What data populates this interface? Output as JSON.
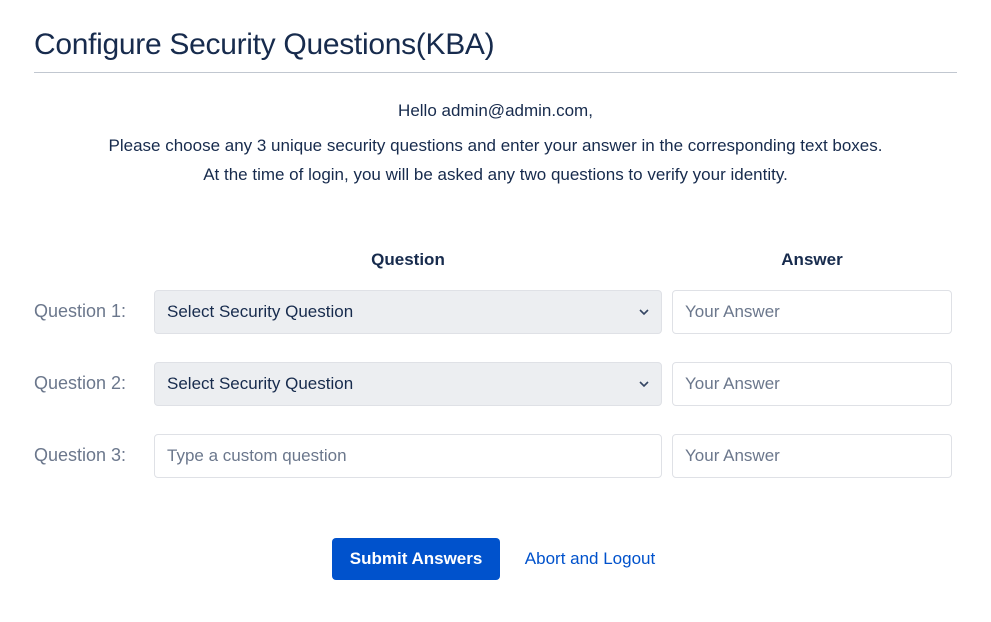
{
  "title": "Configure Security Questions(KBA)",
  "greeting": "Hello admin@admin.com,",
  "instructions_line1": "Please choose any 3 unique security questions and enter your answer in the corresponding text boxes.",
  "instructions_line2": "At the time of login, you will be asked any two questions to verify your identity.",
  "headers": {
    "question": "Question",
    "answer": "Answer"
  },
  "rows": [
    {
      "label": "Question 1:",
      "type": "select",
      "selected": "Select Security Question",
      "answer_placeholder": "Your Answer"
    },
    {
      "label": "Question 2:",
      "type": "select",
      "selected": "Select Security Question",
      "answer_placeholder": "Your Answer"
    },
    {
      "label": "Question 3:",
      "type": "text",
      "placeholder": "Type a custom question",
      "answer_placeholder": "Your Answer"
    }
  ],
  "buttons": {
    "submit": "Submit Answers",
    "abort": "Abort and Logout"
  }
}
